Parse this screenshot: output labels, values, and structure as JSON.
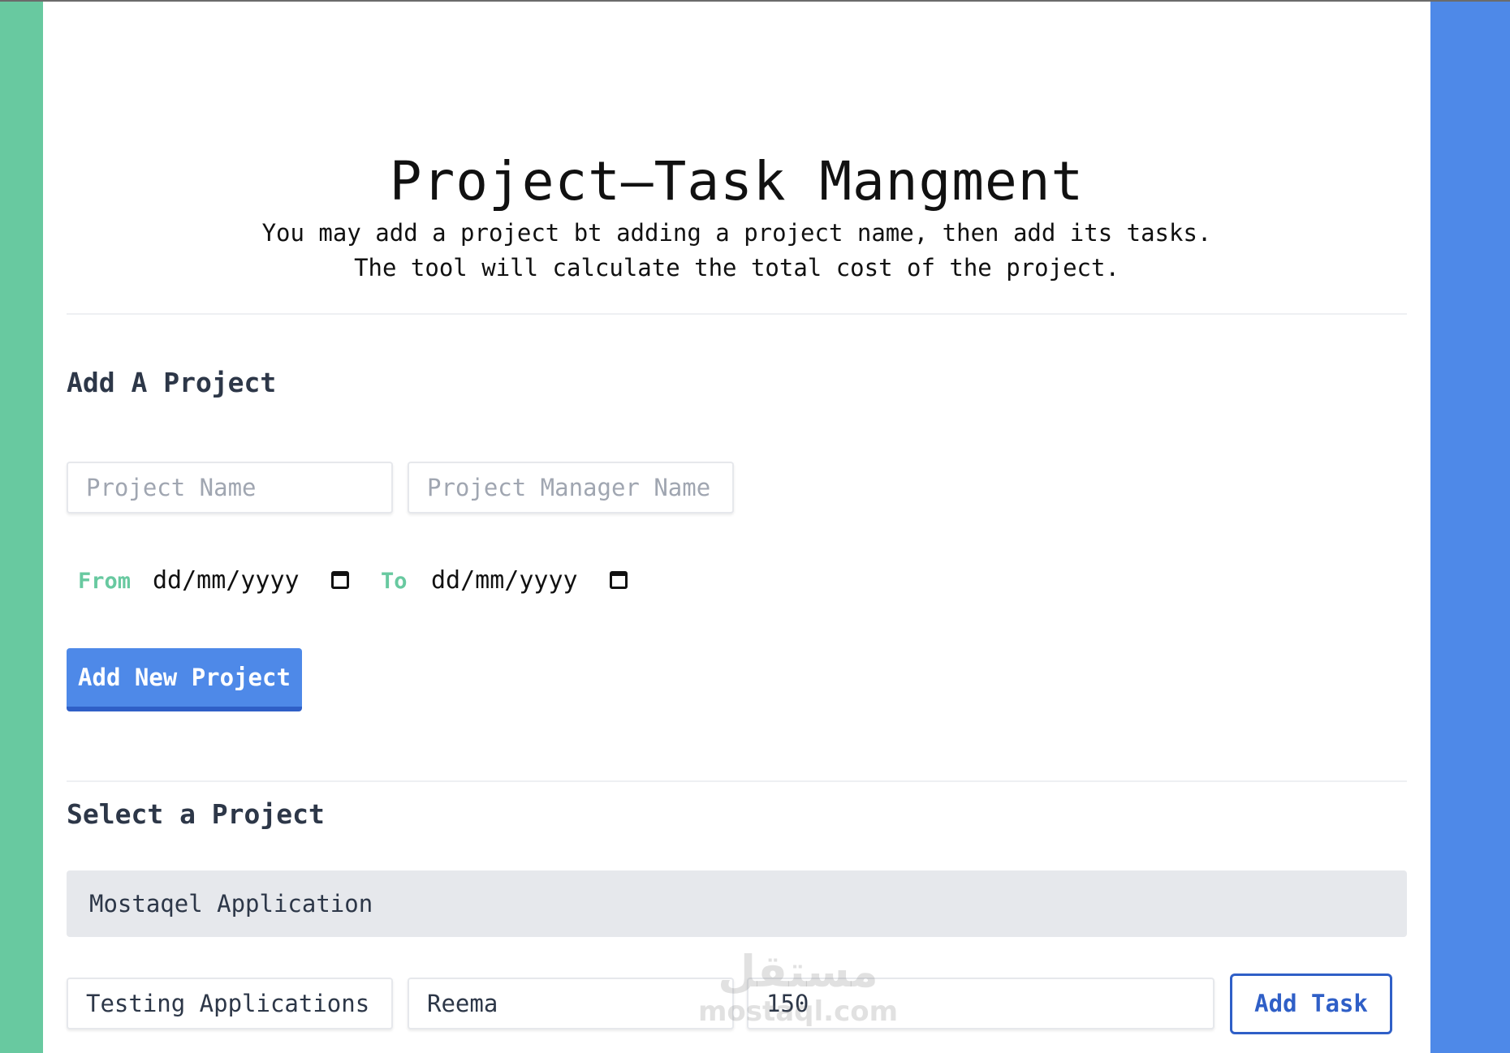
{
  "header": {
    "title": "Project–Task Mangment",
    "description_line1": "You may add a project bt adding a project name, then add its tasks.",
    "description_line2": "The tool will calculate the total cost of the project."
  },
  "add_project": {
    "heading": "Add A Project",
    "project_name_placeholder": "Project Name",
    "manager_name_placeholder": "Project Manager Name",
    "from_label": "From",
    "to_label": "To",
    "from_date_placeholder": "dd/mm/yyyy",
    "to_date_placeholder": "dd/mm/yyyy",
    "submit_label": "Add New Project"
  },
  "select_project": {
    "heading": "Select a Project",
    "selected_value": "Mostaqel Application"
  },
  "task_form": {
    "task_name_value": "Testing Applications",
    "assignee_value": "Reema",
    "cost_value": "150",
    "submit_label": "Add Task"
  },
  "watermark": {
    "arabic": "مستقل",
    "latin": "mostaql.com"
  },
  "colors": {
    "left_accent": "#68c9a0",
    "right_accent": "#4e89e8",
    "primary_button": "#4e89e8",
    "outline_button": "#2f5fc7",
    "date_label": "#68c9a0"
  }
}
